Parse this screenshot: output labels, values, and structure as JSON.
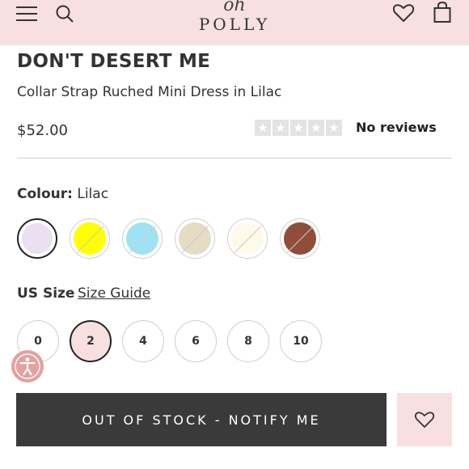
{
  "header": {
    "logo_script": "oh",
    "logo_word": "POLLY",
    "icons": [
      "menu-icon",
      "search-icon",
      "heart-icon",
      "bag-icon"
    ],
    "background": "#f8dfe0"
  },
  "product": {
    "collection": "DON'T DESERT ME",
    "name": "Collar Strap Ruched Mini Dress in Lilac",
    "price": "$52.00",
    "rating_stars": 0,
    "reviews_text": "No reviews"
  },
  "colour": {
    "label": "Colour:",
    "value": "Lilac",
    "swatches": [
      {
        "name": "lilac",
        "color": "#ebdff1",
        "selected": true,
        "unavailable": false
      },
      {
        "name": "yellow",
        "color": "#ffff00",
        "selected": false,
        "unavailable": true
      },
      {
        "name": "light-blue",
        "color": "#9fe3f3",
        "selected": false,
        "unavailable": true
      },
      {
        "name": "beige",
        "color": "#e6dcc4",
        "selected": false,
        "unavailable": true
      },
      {
        "name": "cream",
        "color": "#fefaea",
        "selected": false,
        "unavailable": true
      },
      {
        "name": "brown",
        "color": "#8f4e3a",
        "selected": false,
        "unavailable": true
      }
    ]
  },
  "size": {
    "label": "US Size",
    "guide": "Size Guide",
    "options": [
      "0",
      "2",
      "4",
      "6",
      "8",
      "10"
    ],
    "selected": "2"
  },
  "actions": {
    "notify_label": "OUT OF STOCK - NOTIFY ME",
    "wishlist_icon": "heart-icon",
    "accessibility_icon": "accessibility-icon"
  },
  "colors": {
    "accent_pink": "#f8dfe0",
    "button_dark": "#3a3a3a",
    "access_button": "#e5a0a0"
  }
}
